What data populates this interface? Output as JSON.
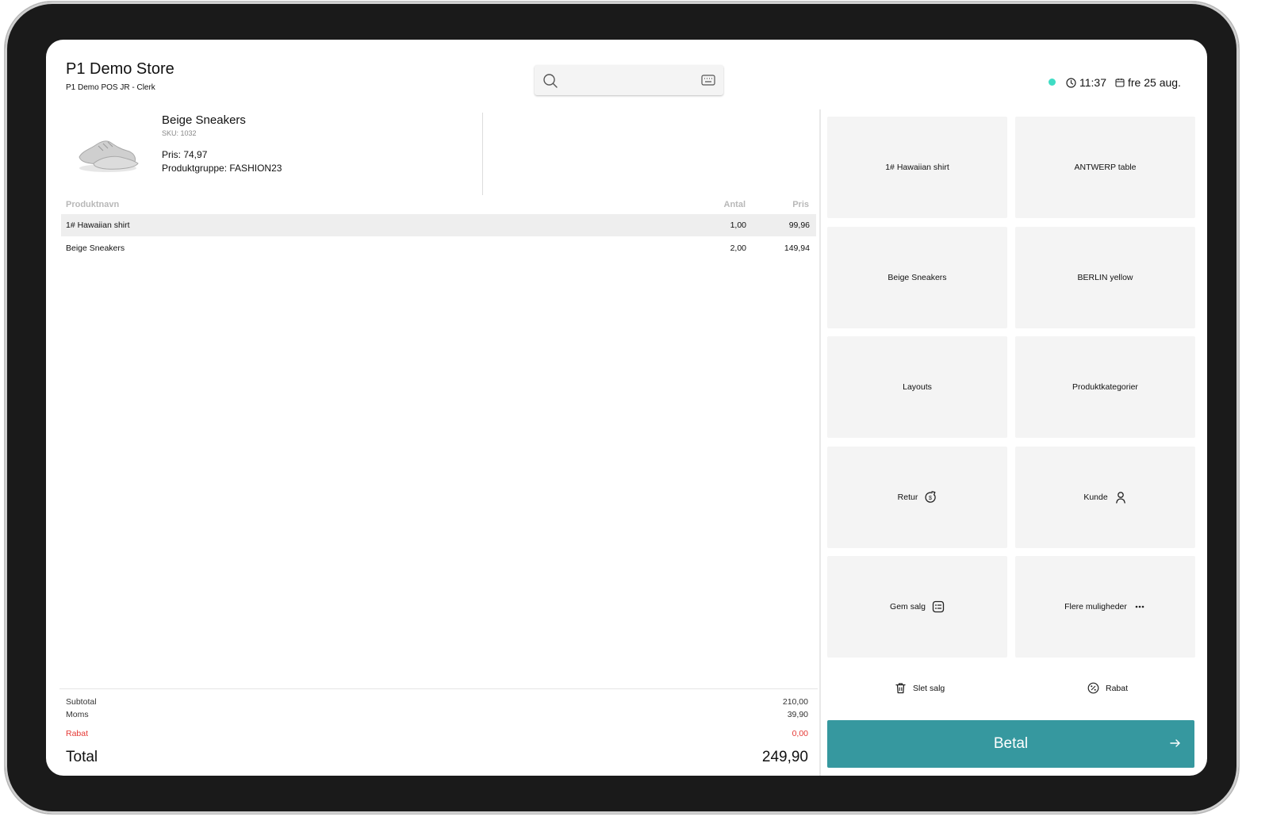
{
  "header": {
    "store_name": "P1 Demo Store",
    "register": "P1 Demo POS JR - Clerk",
    "search_placeholder": "",
    "status_color": "#3fdcc4",
    "time": "11:37",
    "date": "fre 25 aug."
  },
  "product_detail": {
    "name": "Beige Sneakers",
    "sku": "SKU: 1032",
    "price": "Pris: 74,97",
    "group": "Produktgruppe: FASHION23"
  },
  "table": {
    "headers": {
      "name": "Produktnavn",
      "qty": "Antal",
      "price": "Pris"
    },
    "rows": [
      {
        "name": "1# Hawaiian shirt",
        "qty": "1,00",
        "price": "99,96",
        "selected": true
      },
      {
        "name": "Beige Sneakers",
        "qty": "2,00",
        "price": "149,94",
        "selected": false
      }
    ]
  },
  "totals": {
    "subtotal_label": "Subtotal",
    "subtotal_value": "210,00",
    "vat_label": "Moms",
    "vat_value": "39,90",
    "discount_label": "Rabat",
    "discount_value": "0,00",
    "discount_color": "#e53935",
    "total_label": "Total",
    "total_value": "249,90"
  },
  "tiles": [
    {
      "label": "1# Hawaiian shirt",
      "icon": ""
    },
    {
      "label": "ANTWERP table",
      "icon": ""
    },
    {
      "label": "Beige Sneakers",
      "icon": ""
    },
    {
      "label": "BERLIN yellow",
      "icon": ""
    },
    {
      "label": "Layouts",
      "icon": ""
    },
    {
      "label": "Produktkategorier",
      "icon": ""
    },
    {
      "label": "Retur",
      "icon": "return-money-icon"
    },
    {
      "label": "Kunde",
      "icon": "customer-icon"
    },
    {
      "label": "Gem salg",
      "icon": "save-sale-icon"
    },
    {
      "label": "Flere muligheder",
      "icon": "more-dots-icon"
    }
  ],
  "actions": {
    "delete_label": "Slet salg",
    "discount_label": "Rabat"
  },
  "pay": {
    "label": "Betal",
    "color": "#36989f"
  }
}
